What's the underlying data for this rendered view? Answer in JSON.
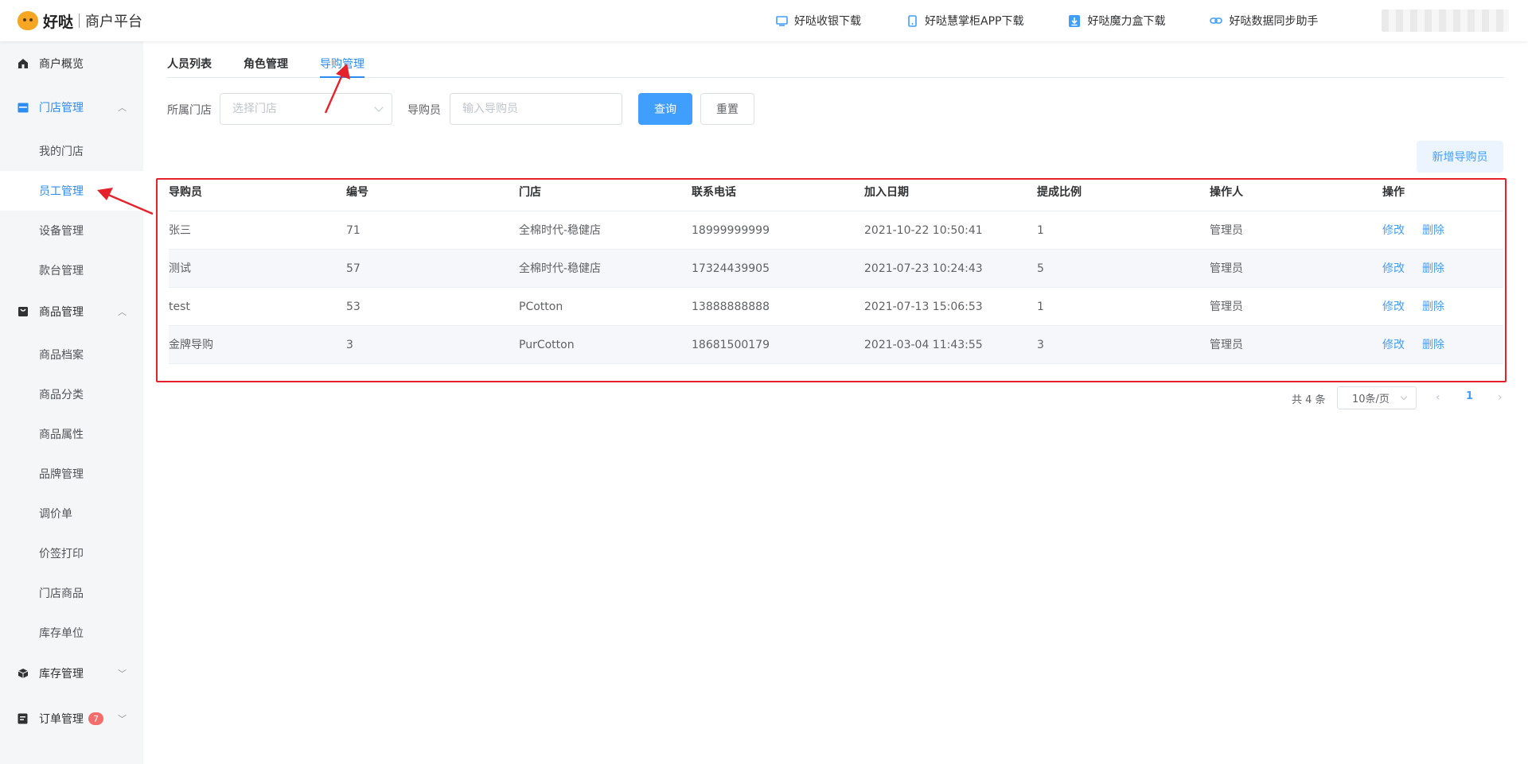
{
  "header": {
    "brand": "好哒",
    "subtitle": "商户平台",
    "links": [
      {
        "label": "好哒收银下载",
        "icon": "monitor-icon"
      },
      {
        "label": "好哒慧掌柜APP下载",
        "icon": "phone-icon"
      },
      {
        "label": "好哒魔力盒下载",
        "icon": "download-icon"
      },
      {
        "label": "好哒数据同步助手",
        "icon": "link-icon"
      }
    ]
  },
  "sidebar": {
    "overview": "商户概览",
    "store_mgmt": "门店管理",
    "store_items": [
      "我的门店",
      "员工管理",
      "设备管理",
      "款台管理"
    ],
    "goods_mgmt": "商品管理",
    "goods_items": [
      "商品档案",
      "商品分类",
      "商品属性",
      "品牌管理",
      "调价单",
      "价签打印",
      "门店商品",
      "库存单位"
    ],
    "stock_mgmt": "库存管理",
    "order_mgmt": "订单管理",
    "order_badge": "7"
  },
  "tabs": [
    "人员列表",
    "角色管理",
    "导购管理"
  ],
  "filters": {
    "store_label": "所属门店",
    "store_placeholder": "选择门店",
    "guide_label": "导购员",
    "guide_placeholder": "输入导购员",
    "query_button": "查询",
    "reset_button": "重置"
  },
  "add_button": "新增导购员",
  "table": {
    "headers": [
      "导购员",
      "编号",
      "门店",
      "联系电话",
      "加入日期",
      "提成比例",
      "操作人",
      "操作"
    ],
    "rows": [
      {
        "name": "张三",
        "code": "71",
        "store": "全棉时代-稳健店",
        "phone": "18999999999",
        "date": "2021-10-22 10:50:41",
        "ratio": "1",
        "operator": "管理员"
      },
      {
        "name": "测试",
        "code": "57",
        "store": "全棉时代-稳健店",
        "phone": "17324439905",
        "date": "2021-07-23 10:24:43",
        "ratio": "5",
        "operator": "管理员"
      },
      {
        "name": "test",
        "code": "53",
        "store": "PCotton",
        "phone": "13888888888",
        "date": "2021-07-13 15:06:53",
        "ratio": "1",
        "operator": "管理员"
      },
      {
        "name": "金牌导购",
        "code": "3",
        "store": "PurCotton",
        "phone": "18681500179",
        "date": "2021-03-04 11:43:55",
        "ratio": "3",
        "operator": "管理员"
      }
    ],
    "edit_label": "修改",
    "delete_label": "删除"
  },
  "pagination": {
    "total": "共 4 条",
    "page_size": "10条/页",
    "current_page": "1"
  },
  "colors": {
    "accent": "#409eff",
    "active_text": "#2d8cf0",
    "annotation_red": "#e5222b",
    "sidebar_bg": "#f5f6f8"
  }
}
